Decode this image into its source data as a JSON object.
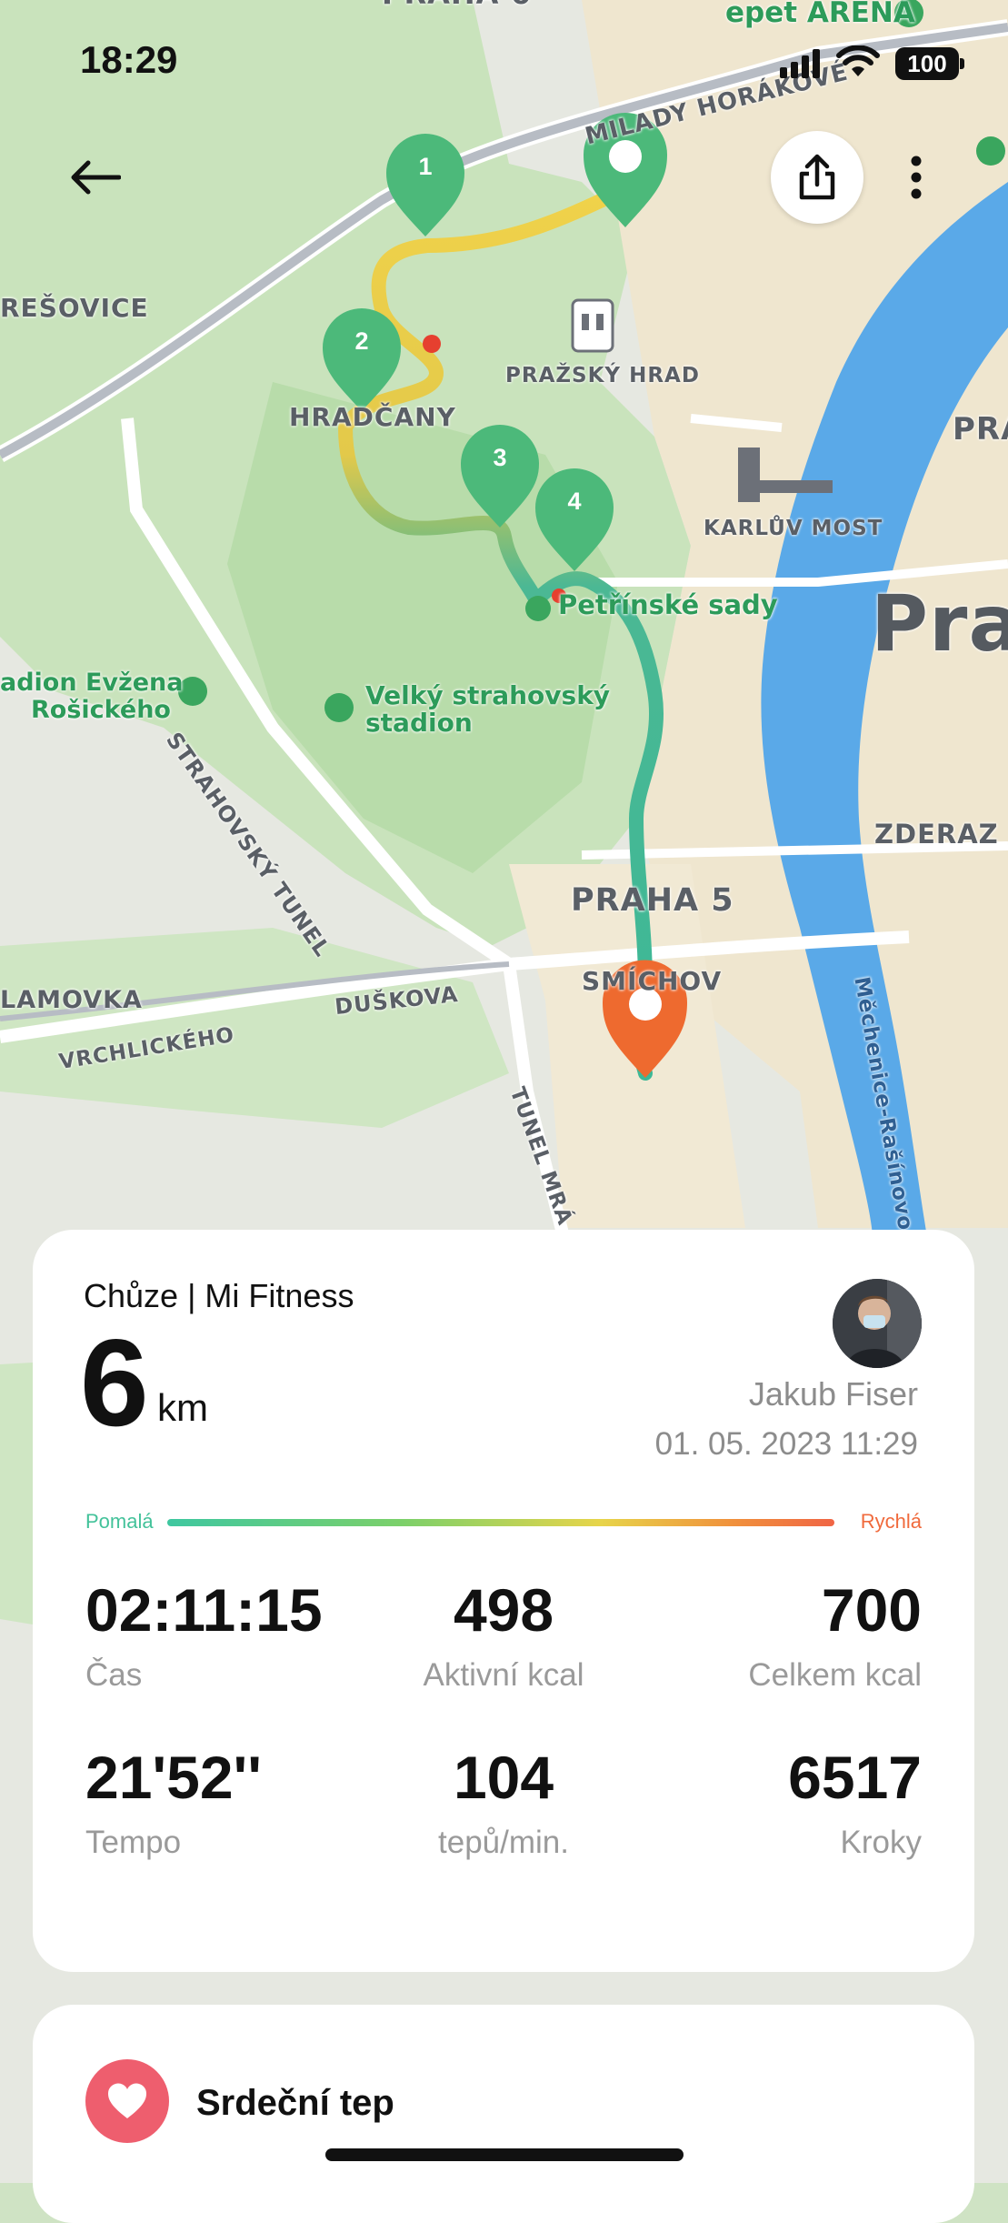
{
  "status_bar": {
    "time": "18:29",
    "battery": "100"
  },
  "map": {
    "labels": {
      "milady": "MILADY HORÁKOVÉ",
      "resovice": "REŠOVICE",
      "hradcany": "HRADČANY",
      "prazsky_hrad": "PRAŽSKÝ HRAD",
      "karluv_most": "KARLŮV MOST",
      "petrinske": "Petřínské sady",
      "strahovsky_tunel": "STRAHOVSKÝ TUNEL",
      "stadion_rosickeho": "adion Evžena Rošického",
      "stadion_rosickeho_1": "adion Evžena",
      "stadion_rosickeho_2": "Rošického",
      "velky_strahovsky_1": "Velký strahovský",
      "velky_strahovsky_2": "stadion",
      "zderaz": "ZDERAZ",
      "praha5": "PRAHA 5",
      "smichov": "SMÍCHOV",
      "lamovka": "LAMOVKA",
      "duskova": "DUŠKOVA",
      "vrchlickeho": "VRCHLICKÉHO",
      "tunel_mrazovka": "TUNEL MRÁ",
      "mechenice": "Měchenice-Rašínovo",
      "praha_big": "Pral",
      "pra_right": "PRA",
      "arena": "epet ARENA",
      "praha_top": "PRAHA 6"
    },
    "markers": [
      "1",
      "2",
      "3",
      "4"
    ]
  },
  "summary": {
    "activity": "Chůze | Mi Fitness",
    "distance": "6",
    "unit": "km",
    "user": "Jakub Fiser",
    "datetime": "01. 05. 2023 11:29",
    "speed_slow": "Pomalá",
    "speed_fast": "Rychlá",
    "stats": [
      {
        "value": "02:11:15",
        "label": "Čas"
      },
      {
        "value": "498",
        "label": "Aktivní kcal"
      },
      {
        "value": "700",
        "label": "Celkem kcal"
      },
      {
        "value": "21'52''",
        "label": "Tempo"
      },
      {
        "value": "104",
        "label": "tepů/min."
      },
      {
        "value": "6517",
        "label": "Kroky"
      }
    ]
  },
  "heart_section": {
    "label": "Srdeční tep"
  },
  "colors": {
    "route_start": "#4cb97a",
    "route_end": "#ee6a2f",
    "heart": "#ee5e6e",
    "river": "#5aa9e8"
  },
  "icons": [
    "back-arrow-icon",
    "share-icon",
    "more-vertical-icon",
    "heart-icon",
    "signal-icon",
    "wifi-icon",
    "battery-icon",
    "start-pin-icon",
    "end-pin-icon"
  ]
}
